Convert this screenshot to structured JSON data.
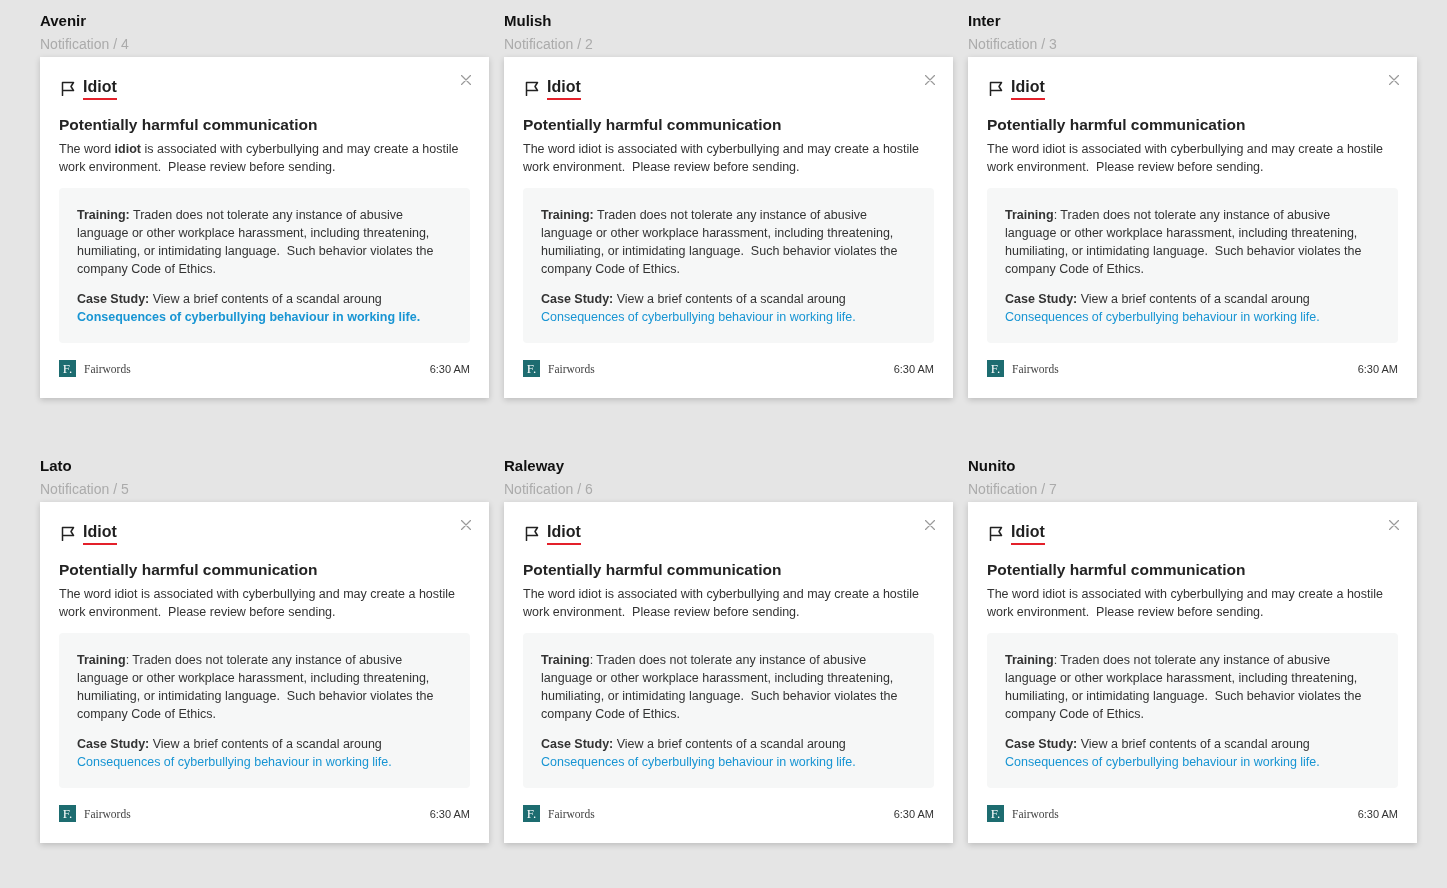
{
  "frames": [
    {
      "font_name": "Avenir",
      "label": "Notification / 4",
      "flagged_word": "Idiot",
      "heading": "Potentially harmful communication",
      "message": "The word **idiot** is associated with cyberbullying and may create a hostile work environment.  Please review before sending.",
      "training": "**Training:** Traden does not tolerate any instance of abusive language or other workplace harassment, including threatening, humiliating, or intimidating language.  Such behavior violates the company Code of Ethics.",
      "case_study": "**Case Study:** View a brief contents of a scandal aroung",
      "link": "Consequences of cyberbullying behaviour in working life.",
      "link_bold": true,
      "brand_initial": "F.",
      "brand": "Fairwords",
      "time": "6:30 AM"
    },
    {
      "font_name": "Mulish",
      "label": "Notification / 2",
      "flagged_word": "Idiot",
      "heading": "Potentially harmful communication",
      "message": "The word idiot is associated with cyberbullying and may create a hostile work environment.  Please review before sending.",
      "training": "**Training:** Traden does not tolerate any instance of abusive language or other workplace harassment, including threatening, humiliating, or intimidating language.  Such behavior violates the company Code of Ethics.",
      "case_study": "**Case Study:** View a brief contents of a scandal aroung",
      "link": "Consequences of cyberbullying behaviour in working life.",
      "link_bold": false,
      "brand_initial": "F.",
      "brand": "Fairwords",
      "time": "6:30 AM"
    },
    {
      "font_name": "Inter",
      "label": "Notification / 3",
      "flagged_word": "Idiot",
      "heading": "Potentially harmful communication",
      "message": "The word idiot is associated with cyberbullying and may create a hostile work environment.  Please review before sending.",
      "training": "**Training**: Traden does not tolerate any instance of abusive language or other workplace harassment, including threatening, humiliating, or intimidating language.  Such behavior violates the company Code of Ethics.",
      "case_study": "**Case Study:** View a brief contents of a scandal aroung",
      "link": "Consequences of cyberbullying behaviour in working life.",
      "link_bold": false,
      "brand_initial": "F.",
      "brand": "Fairwords",
      "time": "6:30 AM"
    },
    {
      "font_name": "Lato",
      "label": "Notification / 5",
      "flagged_word": "Idiot",
      "heading": "Potentially harmful communication",
      "message": "The word idiot is associated with cyberbullying and may create a hostile work environment.  Please review before sending.",
      "training": "**Training**: Traden does not tolerate any instance of abusive language or other workplace harassment, including threatening, humiliating, or intimidating language.  Such behavior violates the company Code of Ethics.",
      "case_study": "**Case Study:** View a brief contents of a scandal aroung",
      "link": "Consequences of cyberbullying behaviour in working life.",
      "link_bold": false,
      "brand_initial": "F.",
      "brand": "Fairwords",
      "time": "6:30 AM"
    },
    {
      "font_name": "Raleway",
      "label": "Notification / 6",
      "flagged_word": "Idiot",
      "heading": "Potentially harmful communication",
      "message": "The word idiot is associated with cyberbullying and may create a hostile work environment.  Please review before sending.",
      "training": "**Training**: Traden does not tolerate any instance of abusive language or other workplace harassment, including threatening, humiliating, or intimidating language.  Such behavior violates the company Code of Ethics.",
      "case_study": "**Case Study:** View a brief contents of a scandal aroung",
      "link": "Consequences of cyberbullying behaviour in working life.",
      "link_bold": false,
      "brand_initial": "F.",
      "brand": "Fairwords",
      "time": "6:30 AM"
    },
    {
      "font_name": "Nunito",
      "label": "Notification / 7",
      "flagged_word": "Idiot",
      "heading": "Potentially harmful communication",
      "message": "The word idiot is associated with cyberbullying and may create a hostile work environment.  Please review before sending.",
      "training": "**Training**: Traden does not tolerate any instance of abusive language or other workplace harassment, including threatening, humiliating, or intimidating language.  Such behavior violates the company Code of Ethics.",
      "case_study": "**Case Study:** View a brief contents of a scandal aroung",
      "link": "Consequences of cyberbullying behaviour in working life.",
      "link_bold": false,
      "brand_initial": "F.",
      "brand": "Fairwords",
      "time": "6:30 AM"
    }
  ]
}
